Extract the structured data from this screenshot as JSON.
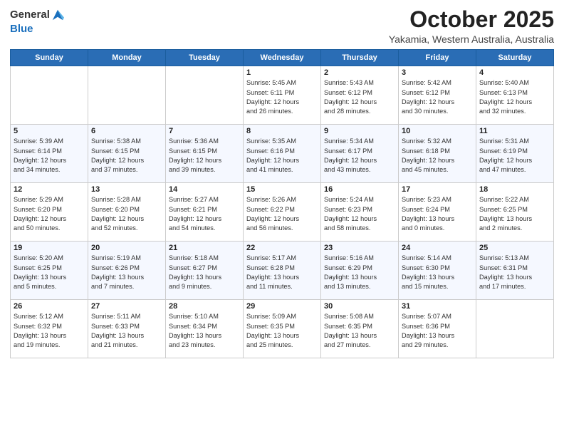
{
  "header": {
    "logo_general": "General",
    "logo_blue": "Blue",
    "month": "October 2025",
    "location": "Yakamia, Western Australia, Australia"
  },
  "weekdays": [
    "Sunday",
    "Monday",
    "Tuesday",
    "Wednesday",
    "Thursday",
    "Friday",
    "Saturday"
  ],
  "weeks": [
    [
      {
        "day": "",
        "detail": ""
      },
      {
        "day": "",
        "detail": ""
      },
      {
        "day": "",
        "detail": ""
      },
      {
        "day": "1",
        "detail": "Sunrise: 5:45 AM\nSunset: 6:11 PM\nDaylight: 12 hours\nand 26 minutes."
      },
      {
        "day": "2",
        "detail": "Sunrise: 5:43 AM\nSunset: 6:12 PM\nDaylight: 12 hours\nand 28 minutes."
      },
      {
        "day": "3",
        "detail": "Sunrise: 5:42 AM\nSunset: 6:12 PM\nDaylight: 12 hours\nand 30 minutes."
      },
      {
        "day": "4",
        "detail": "Sunrise: 5:40 AM\nSunset: 6:13 PM\nDaylight: 12 hours\nand 32 minutes."
      }
    ],
    [
      {
        "day": "5",
        "detail": "Sunrise: 5:39 AM\nSunset: 6:14 PM\nDaylight: 12 hours\nand 34 minutes."
      },
      {
        "day": "6",
        "detail": "Sunrise: 5:38 AM\nSunset: 6:15 PM\nDaylight: 12 hours\nand 37 minutes."
      },
      {
        "day": "7",
        "detail": "Sunrise: 5:36 AM\nSunset: 6:15 PM\nDaylight: 12 hours\nand 39 minutes."
      },
      {
        "day": "8",
        "detail": "Sunrise: 5:35 AM\nSunset: 6:16 PM\nDaylight: 12 hours\nand 41 minutes."
      },
      {
        "day": "9",
        "detail": "Sunrise: 5:34 AM\nSunset: 6:17 PM\nDaylight: 12 hours\nand 43 minutes."
      },
      {
        "day": "10",
        "detail": "Sunrise: 5:32 AM\nSunset: 6:18 PM\nDaylight: 12 hours\nand 45 minutes."
      },
      {
        "day": "11",
        "detail": "Sunrise: 5:31 AM\nSunset: 6:19 PM\nDaylight: 12 hours\nand 47 minutes."
      }
    ],
    [
      {
        "day": "12",
        "detail": "Sunrise: 5:29 AM\nSunset: 6:20 PM\nDaylight: 12 hours\nand 50 minutes."
      },
      {
        "day": "13",
        "detail": "Sunrise: 5:28 AM\nSunset: 6:20 PM\nDaylight: 12 hours\nand 52 minutes."
      },
      {
        "day": "14",
        "detail": "Sunrise: 5:27 AM\nSunset: 6:21 PM\nDaylight: 12 hours\nand 54 minutes."
      },
      {
        "day": "15",
        "detail": "Sunrise: 5:26 AM\nSunset: 6:22 PM\nDaylight: 12 hours\nand 56 minutes."
      },
      {
        "day": "16",
        "detail": "Sunrise: 5:24 AM\nSunset: 6:23 PM\nDaylight: 12 hours\nand 58 minutes."
      },
      {
        "day": "17",
        "detail": "Sunrise: 5:23 AM\nSunset: 6:24 PM\nDaylight: 13 hours\nand 0 minutes."
      },
      {
        "day": "18",
        "detail": "Sunrise: 5:22 AM\nSunset: 6:25 PM\nDaylight: 13 hours\nand 2 minutes."
      }
    ],
    [
      {
        "day": "19",
        "detail": "Sunrise: 5:20 AM\nSunset: 6:25 PM\nDaylight: 13 hours\nand 5 minutes."
      },
      {
        "day": "20",
        "detail": "Sunrise: 5:19 AM\nSunset: 6:26 PM\nDaylight: 13 hours\nand 7 minutes."
      },
      {
        "day": "21",
        "detail": "Sunrise: 5:18 AM\nSunset: 6:27 PM\nDaylight: 13 hours\nand 9 minutes."
      },
      {
        "day": "22",
        "detail": "Sunrise: 5:17 AM\nSunset: 6:28 PM\nDaylight: 13 hours\nand 11 minutes."
      },
      {
        "day": "23",
        "detail": "Sunrise: 5:16 AM\nSunset: 6:29 PM\nDaylight: 13 hours\nand 13 minutes."
      },
      {
        "day": "24",
        "detail": "Sunrise: 5:14 AM\nSunset: 6:30 PM\nDaylight: 13 hours\nand 15 minutes."
      },
      {
        "day": "25",
        "detail": "Sunrise: 5:13 AM\nSunset: 6:31 PM\nDaylight: 13 hours\nand 17 minutes."
      }
    ],
    [
      {
        "day": "26",
        "detail": "Sunrise: 5:12 AM\nSunset: 6:32 PM\nDaylight: 13 hours\nand 19 minutes."
      },
      {
        "day": "27",
        "detail": "Sunrise: 5:11 AM\nSunset: 6:33 PM\nDaylight: 13 hours\nand 21 minutes."
      },
      {
        "day": "28",
        "detail": "Sunrise: 5:10 AM\nSunset: 6:34 PM\nDaylight: 13 hours\nand 23 minutes."
      },
      {
        "day": "29",
        "detail": "Sunrise: 5:09 AM\nSunset: 6:35 PM\nDaylight: 13 hours\nand 25 minutes."
      },
      {
        "day": "30",
        "detail": "Sunrise: 5:08 AM\nSunset: 6:35 PM\nDaylight: 13 hours\nand 27 minutes."
      },
      {
        "day": "31",
        "detail": "Sunrise: 5:07 AM\nSunset: 6:36 PM\nDaylight: 13 hours\nand 29 minutes."
      },
      {
        "day": "",
        "detail": ""
      }
    ]
  ]
}
